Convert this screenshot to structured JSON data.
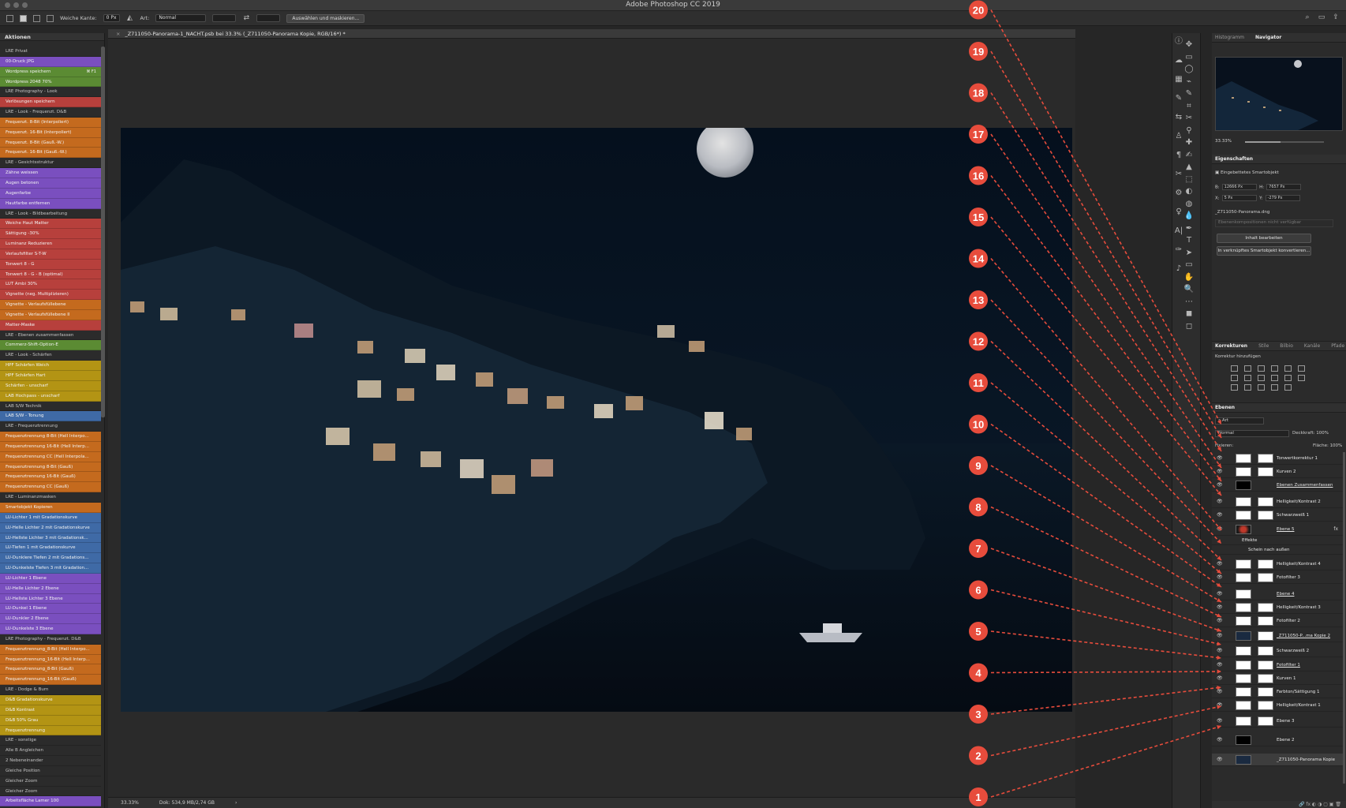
{
  "window": {
    "title": "Adobe Photoshop CC 2019"
  },
  "options_bar": {
    "soft_edge_label": "Weiche Kante:",
    "soft_edge_value": "0 Px",
    "style_label": "Art:",
    "style_value": "Normal",
    "select_mask_button": "Auswählen und maskieren..."
  },
  "actions_panel": {
    "tab": "Aktionen",
    "items": [
      {
        "label": "LRE Privat",
        "color": "gray"
      },
      {
        "label": "00-Druck JPG",
        "color": "purple"
      },
      {
        "label": "Wordpress speichern",
        "color": "green",
        "shortcut": "⌘ F1"
      },
      {
        "label": "Wordpress 2048 70%",
        "color": "green"
      },
      {
        "label": "LRE Photography - Look",
        "color": "gray"
      },
      {
        "label": "Verlösungen speichern",
        "color": "red"
      },
      {
        "label": "LRE - Look - Frequenzt. D&B",
        "color": "gray"
      },
      {
        "label": "Frequenzt. 8-Bit (Interpoliert)",
        "color": "orange"
      },
      {
        "label": "Frequenzt. 16-Bit (Interpoliert)",
        "color": "orange"
      },
      {
        "label": "Frequenzt. 8-Bit (Gauß.-W.)",
        "color": "orange"
      },
      {
        "label": "Frequenzt. 16-Bit (Gauß.-W.)",
        "color": "orange"
      },
      {
        "label": "LRE - Gesichtsstruktur",
        "color": "gray"
      },
      {
        "label": "Zähne weissen",
        "color": "purple"
      },
      {
        "label": "Augen betonen",
        "color": "purple"
      },
      {
        "label": "Augenfarbe",
        "color": "purple"
      },
      {
        "label": "Hautfarbe entfernen",
        "color": "purple"
      },
      {
        "label": "LRE - Look - Bildbearbeitung",
        "color": "gray"
      },
      {
        "label": "Weiche Haut Matter",
        "color": "red"
      },
      {
        "label": "Sättigung -30%",
        "color": "red"
      },
      {
        "label": "Luminanz Reduzieren",
        "color": "red"
      },
      {
        "label": "Verlaufsfilter S-T-W",
        "color": "red"
      },
      {
        "label": "Tonwert 8 - G",
        "color": "red"
      },
      {
        "label": "Tonwert 8 - G - B (optimal)",
        "color": "red"
      },
      {
        "label": "LUT Ambi 30%",
        "color": "red"
      },
      {
        "label": "Vignette (neg. Multiplizieren)",
        "color": "red"
      },
      {
        "label": "Vignette - Verlaufsfüllebene",
        "color": "orange"
      },
      {
        "label": "Vignette - Verlaufsfüllebene II",
        "color": "orange"
      },
      {
        "label": "Matter-Maske",
        "color": "red"
      },
      {
        "label": "LRE - Ebenen zusammenfassen",
        "color": "gray"
      },
      {
        "label": "Commerz-Shift-Option-E",
        "color": "green"
      },
      {
        "label": "LRE - Look - Schärfen",
        "color": "gray"
      },
      {
        "label": "HPF Schärfen Weich",
        "color": "yellow"
      },
      {
        "label": "HPF Schärfen Hart",
        "color": "yellow"
      },
      {
        "label": "Schärfen - unscharf",
        "color": "yellow"
      },
      {
        "label": "LAB Hochpass - unscharf",
        "color": "yellow"
      },
      {
        "label": "LAB S/W Technik",
        "color": "gray"
      },
      {
        "label": "LAB S/W - Tonung",
        "color": "blue"
      },
      {
        "label": "LRE - Frequenztrennung",
        "color": "gray"
      },
      {
        "label": "Frequenztrennung 8-Bit (Hell Interpo...",
        "color": "orange"
      },
      {
        "label": "Frequenztrennung 16-Bit (Hell Interp...",
        "color": "orange"
      },
      {
        "label": "Frequenztrennung CC (Hell Interpola...",
        "color": "orange"
      },
      {
        "label": "Frequenztrennung 8-Bit (Gauß)",
        "color": "orange"
      },
      {
        "label": "Frequenztrennung 16-Bit (Gauß)",
        "color": "orange"
      },
      {
        "label": "Frequenztrennung CC (Gauß)",
        "color": "orange"
      },
      {
        "label": "LRE - Luminanzmasken",
        "color": "gray"
      },
      {
        "label": "Smartobjekt Kopieren",
        "color": "orange"
      },
      {
        "label": "LU-Lichter 1 mit Gradationskurve",
        "color": "blue"
      },
      {
        "label": "LU-Helle Lichter 2 mit Gradationskurve",
        "color": "blue"
      },
      {
        "label": "LU-Hellste Lichter 3 mit Gradationsk...",
        "color": "blue"
      },
      {
        "label": "LU-Tiefen 1 mit Gradationskurve",
        "color": "blue"
      },
      {
        "label": "LU-Dunklere Tiefen 2 mit Gradations...",
        "color": "blue"
      },
      {
        "label": "LU-Dunkelste Tiefen 3 mit Gradation...",
        "color": "blue"
      },
      {
        "label": "LU-Lichter 1 Ebene",
        "color": "purple"
      },
      {
        "label": "LU-Helle Lichter 2 Ebene",
        "color": "purple"
      },
      {
        "label": "LU-Hellste Lichter 3 Ebene",
        "color": "purple"
      },
      {
        "label": "LU-Dunkel 1 Ebene",
        "color": "purple"
      },
      {
        "label": "LU-Dunkler 2 Ebene",
        "color": "purple"
      },
      {
        "label": "LU-Dunkelste 3 Ebene",
        "color": "purple"
      },
      {
        "label": "LRE Photography - Frequenzt. D&B",
        "color": "gray"
      },
      {
        "label": "Frequenztrennung_8-Bit (Hell Interpo...",
        "color": "orange"
      },
      {
        "label": "Frequenztrennung_16-Bit (Hell Interp...",
        "color": "orange"
      },
      {
        "label": "Frequenztrennung_8-Bit (Gauß)",
        "color": "orange"
      },
      {
        "label": "Frequenztrennung_16-Bit (Gauß)",
        "color": "orange"
      },
      {
        "label": "LRE - Dodge & Burn",
        "color": "gray"
      },
      {
        "label": "D&B Gradationskurve",
        "color": "yellow"
      },
      {
        "label": "D&B Kontrast",
        "color": "yellow"
      },
      {
        "label": "D&B 50% Grau",
        "color": "yellow"
      },
      {
        "label": "Frequenztrennung",
        "color": "yellow"
      },
      {
        "label": "LRE - sonstige",
        "color": "gray"
      },
      {
        "label": "Alle B Angleichen",
        "color": "gray"
      },
      {
        "label": "2 Nebeneinander",
        "color": "gray"
      },
      {
        "label": "Gleiche Position",
        "color": "gray"
      },
      {
        "label": "Gleicher Zoom",
        "color": "gray"
      },
      {
        "label": "Gleicher Zoom",
        "color": "gray"
      },
      {
        "label": "Arbeitsfläche Lamer 100",
        "color": "purple"
      }
    ]
  },
  "document": {
    "tab_title": "_Z711050-Panorama-1_NACHT.psb bei 33.3% (_Z711050-Panorama Kopie, RGB/16*) *",
    "status_zoom": "33.33%",
    "status_doc": "Dok: 534,9 MB/2,74 GB"
  },
  "annotations": [
    "1",
    "2",
    "3",
    "4",
    "5",
    "6",
    "7",
    "8",
    "9",
    "10",
    "11",
    "12",
    "13",
    "14",
    "15",
    "16",
    "17",
    "18",
    "19",
    "20"
  ],
  "navigator": {
    "tabs": [
      "Histogramm",
      "Navigator"
    ],
    "active_tab": "Navigator",
    "zoom": "33.33%",
    "zoom_fraction": 0.45
  },
  "properties": {
    "title": "Eigenschaften",
    "object_type": "Eingebettetes Smartobjekt",
    "w_label": "B:",
    "w_value": "12666 Px",
    "h_label": "H:",
    "h_value": "7657 Px",
    "x_label": "X:",
    "x_value": "5 Px",
    "y_label": "Y:",
    "y_value": "-279 Px",
    "filename": "_Z711050-Panorama.dng",
    "comp_label": "Ebenenkompositionen nicht verfügbar",
    "edit_button": "Inhalt bearbeiten",
    "convert_button": "In verknüpftes Smartobjekt konvertieren..."
  },
  "corrections": {
    "tabs": [
      "Korrekturen",
      "Stile",
      "Bilbio",
      "Kanäle",
      "Pfade"
    ],
    "active_tab": "Korrekturen",
    "add_label": "Korrektur hinzufügen"
  },
  "layers_panel": {
    "title": "Ebenen",
    "filter": "Art",
    "blend_mode": "Normal",
    "opacity_label": "Deckkraft:",
    "opacity_value": "100%",
    "lock_label": "Fixieren:",
    "fill_label": "Fläche:",
    "fill_value": "100%",
    "layers": [
      {
        "name": "Tonwertkorrektur 1",
        "thumb": "white",
        "mask": true
      },
      {
        "name": "Kurven 2",
        "thumb": "white",
        "mask": true
      },
      {
        "name": "Ebenen Zusammenfassen",
        "thumb": "dark",
        "mask": false,
        "underline": true
      },
      {
        "name": "Helligkeit/Kontrast 2",
        "thumb": "white",
        "mask": true
      },
      {
        "name": "Schwarzweiß 1",
        "thumb": "white",
        "mask": true
      },
      {
        "name": "Ebene 5",
        "thumb": "red",
        "mask": false,
        "fx": "fx",
        "underline": true
      },
      {
        "name": "Effekte",
        "thumb": "none",
        "mask": false
      },
      {
        "name": "Schein nach außen",
        "thumb": "none",
        "mask": false
      },
      {
        "name": "Helligkeit/Kontrast 4",
        "thumb": "white",
        "mask": true
      },
      {
        "name": "Fotofilter 3",
        "thumb": "white",
        "mask": true
      },
      {
        "name": "Ebene 4",
        "thumb": "white",
        "mask": false,
        "underline": true
      },
      {
        "name": "Helligkeit/Kontrast 3",
        "thumb": "white",
        "mask": true
      },
      {
        "name": "Fotofilter 2",
        "thumb": "white",
        "mask": true
      },
      {
        "name": "_Z711050-P...ma Kopie 2",
        "thumb": "photo",
        "mask": true,
        "underline": true
      },
      {
        "name": "Schwarzweiß 2",
        "thumb": "white",
        "mask": true
      },
      {
        "name": "Fotofilter 1",
        "thumb": "white",
        "mask": true,
        "underline": true
      },
      {
        "name": "Kurven 1",
        "thumb": "white",
        "mask": true
      },
      {
        "name": "Farbton/Sättigung 1",
        "thumb": "white",
        "mask": true
      },
      {
        "name": "Helligkeit/Kontrast 1",
        "thumb": "white",
        "mask": true
      },
      {
        "name": "Ebene 3",
        "thumb": "white",
        "mask": true
      },
      {
        "name": "Ebene 2",
        "thumb": "dark",
        "mask": false
      },
      {
        "name": "_Z711050-Panorama Kopie",
        "thumb": "photo",
        "mask": false,
        "selected": true
      }
    ]
  },
  "colors": {
    "annotation_red": "#e74c3c",
    "panel_bg": "#2b2b2b"
  }
}
